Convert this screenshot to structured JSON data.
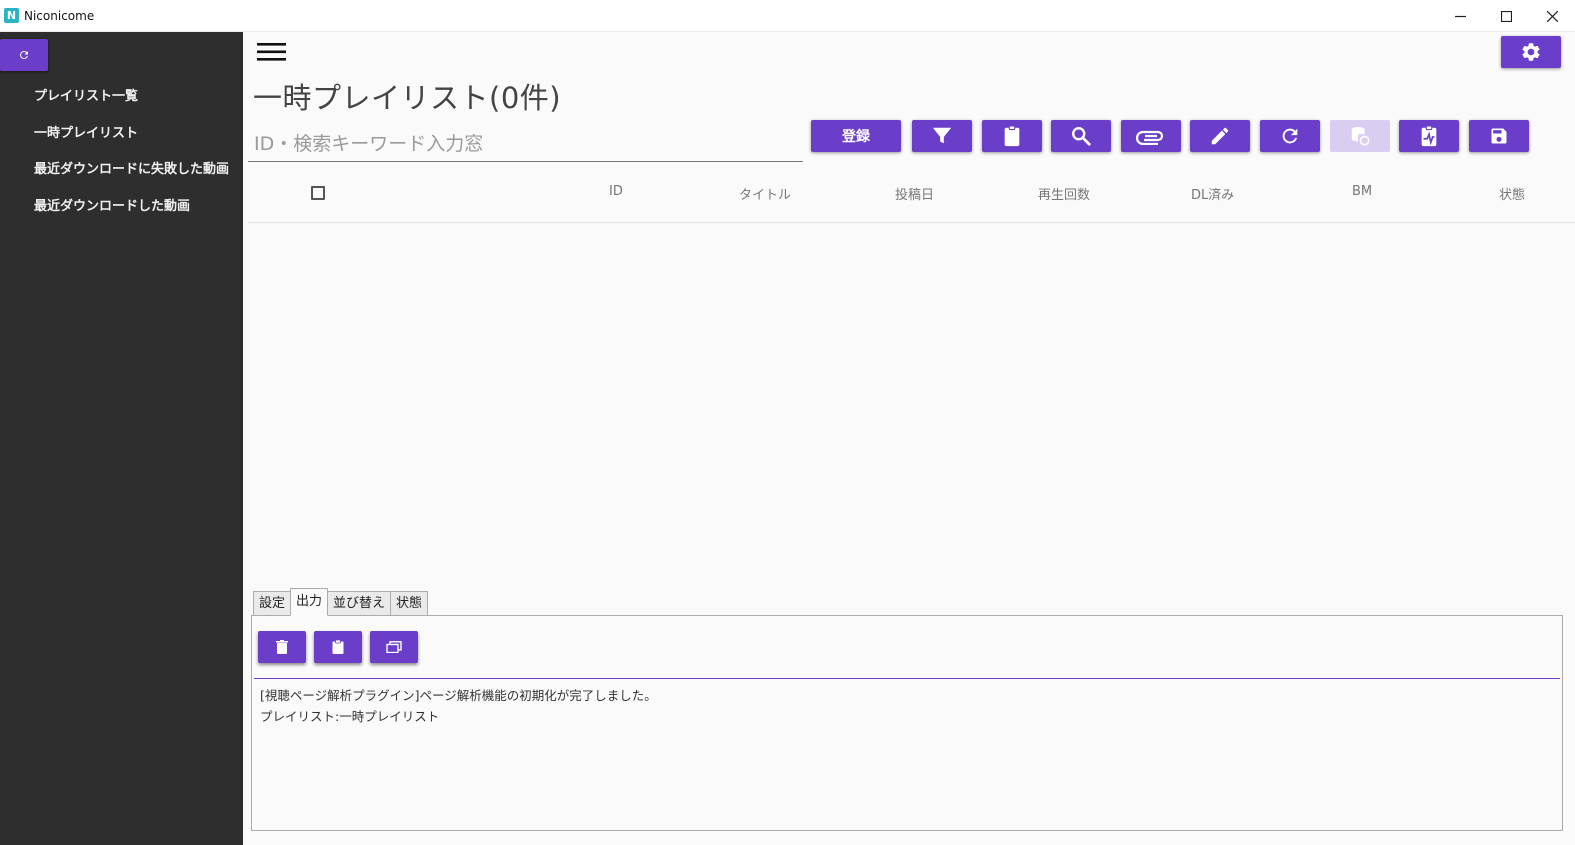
{
  "window": {
    "title": "Niconicome",
    "logo_letter": "N",
    "controls": [
      "minimize-icon",
      "maximize-icon",
      "close-icon"
    ]
  },
  "sidebar": {
    "refresh_icon": "refresh-icon",
    "items": [
      {
        "label": "プレイリスト一覧"
      },
      {
        "label": "一時プレイリスト"
      },
      {
        "label": "最近ダウンロードに失敗した動画"
      },
      {
        "label": "最近ダウンロードした動画"
      }
    ]
  },
  "header": {
    "menu_icon": "hamburger-menu-icon",
    "settings_icon": "gear-icon",
    "page_title": "一時プレイリスト(0件)"
  },
  "search": {
    "placeholder": "ID・検索キーワード入力窓",
    "value": ""
  },
  "toolbar": {
    "register_label": "登録",
    "icons": [
      "filter-icon",
      "clipboard-icon",
      "search-icon",
      "paperclip-icon",
      "pencil-icon",
      "refresh-icon",
      "database-sync-icon",
      "chart-clipboard-icon",
      "save-icon"
    ],
    "disabled": [
      "database-sync-icon"
    ]
  },
  "table": {
    "columns": [
      "ID",
      "タイトル",
      "投稿日",
      "再生回数",
      "DL済み",
      "BM",
      "状態"
    ],
    "rows": []
  },
  "bottom_tabs": [
    {
      "label": "設定",
      "active": false
    },
    {
      "label": "出力",
      "active": true
    },
    {
      "label": "並び替え",
      "active": false
    },
    {
      "label": "状態",
      "active": false
    }
  ],
  "output_panel": {
    "buttons": [
      "trash-icon",
      "clipboard-icon",
      "window-icon"
    ],
    "log": [
      "[視聴ページ解析プラグイン]ページ解析機能の初期化が完了しました。",
      "プレイリスト:一時プレイリスト"
    ]
  },
  "colors": {
    "accent": "#6a3ec8",
    "accent_disabled": "#d9cdf1",
    "sidebar_bg": "#2e2e2e",
    "main_bg": "#fafafa"
  }
}
